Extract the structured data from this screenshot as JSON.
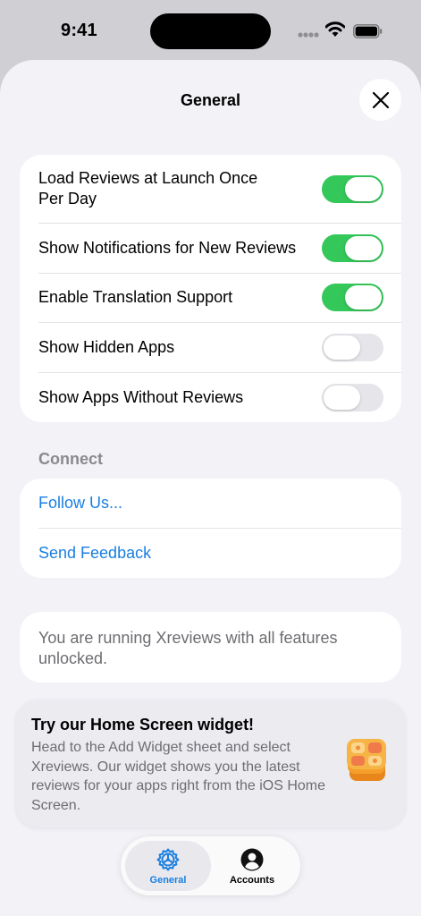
{
  "status_bar": {
    "time": "9:41"
  },
  "sheet": {
    "title": "General"
  },
  "settings": {
    "toggles": [
      {
        "label": "Load Reviews at Launch Once Per Day",
        "enabled": true
      },
      {
        "label": "Show Notifications for New Reviews",
        "enabled": true
      },
      {
        "label": "Enable Translation Support",
        "enabled": true
      },
      {
        "label": "Show Hidden Apps",
        "enabled": false
      },
      {
        "label": "Show Apps Without Reviews",
        "enabled": false
      }
    ]
  },
  "connect": {
    "header": "Connect",
    "links": [
      {
        "label": "Follow Us..."
      },
      {
        "label": "Send Feedback"
      }
    ]
  },
  "info": {
    "text": "You are running Xreviews with all features unlocked."
  },
  "widget_promo": {
    "title": "Try our Home Screen widget!",
    "description": "Head to the Add Widget sheet and select Xreviews. Our widget shows you the latest reviews for your apps right from the iOS Home Screen.",
    "icon": "widget-stack-icon"
  },
  "tab_bar": {
    "tabs": [
      {
        "label": "General",
        "icon": "gear-icon",
        "active": true
      },
      {
        "label": "Accounts",
        "icon": "person-circle-icon",
        "active": false
      }
    ]
  },
  "colors": {
    "accent": "#1a7fe0",
    "toggle_on": "#34c759",
    "toggle_off": "#e5e5ea"
  }
}
